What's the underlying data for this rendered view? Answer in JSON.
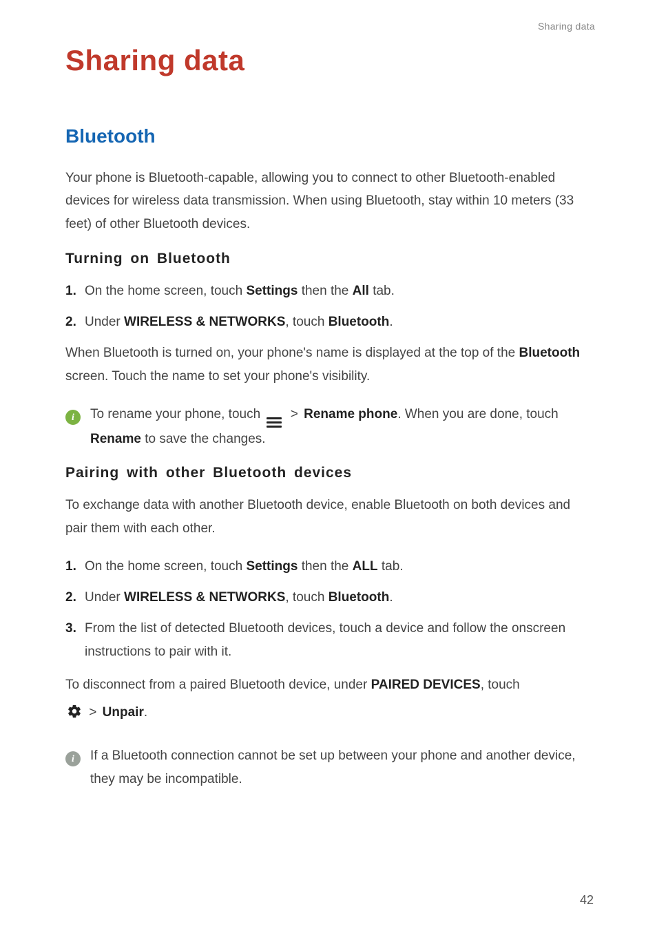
{
  "runningHead": "Sharing data",
  "title": "Sharing data",
  "sections": {
    "bluetooth": {
      "heading": "Bluetooth",
      "intro": "Your phone is Bluetooth-capable, allowing you to connect to other Bluetooth-enabled devices for wireless data transmission. When using Bluetooth, stay within 10 meters (33 feet) of other Bluetooth devices.",
      "turnOn": {
        "heading": "Turning on Bluetooth",
        "step1_a": "On the home screen, touch ",
        "step1_b": "Settings",
        "step1_c": " then the ",
        "step1_d": "All",
        "step1_e": " tab.",
        "step2_a": "Under ",
        "step2_b": "WIRELESS & NETWORKS",
        "step2_c": ", touch ",
        "step2_d": "Bluetooth",
        "step2_e": ".",
        "after_a": "When Bluetooth is turned on, your phone's name is displayed at the top of the ",
        "after_b": "Bluetooth",
        "after_c": " screen. Touch the name to set your phone's visibility.",
        "note_a": "To rename your phone, touch ",
        "note_gt": ">",
        "note_b": "Rename phone",
        "note_c": ". When you are done, touch ",
        "note_d": "Rename",
        "note_e": " to save the changes."
      },
      "pairing": {
        "heading": "Pairing with other Bluetooth devices",
        "intro": "To exchange data with another Bluetooth device, enable Bluetooth on both devices and pair them with each other.",
        "step1_a": "On the home screen, touch ",
        "step1_b": "Settings",
        "step1_c": " then the ",
        "step1_d": "ALL",
        "step1_e": " tab.",
        "step2_a": "Under ",
        "step2_b": "WIRELESS & NETWORKS",
        "step2_c": ", touch ",
        "step2_d": "Bluetooth",
        "step2_e": ".",
        "step3": "From the list of detected Bluetooth devices, touch a device and follow the onscreen instructions to pair with it.",
        "disc_a": "To disconnect from a paired Bluetooth device, under ",
        "disc_b": "PAIRED DEVICES",
        "disc_c": ", touch ",
        "disc_gt": ">",
        "disc_d": "Unpair",
        "disc_e": ".",
        "note": "If a Bluetooth connection cannot be set up between your phone and another device, they may be incompatible."
      }
    }
  },
  "nums": {
    "n1": "1.",
    "n2": "2.",
    "n3": "3."
  },
  "pageNumber": "42"
}
